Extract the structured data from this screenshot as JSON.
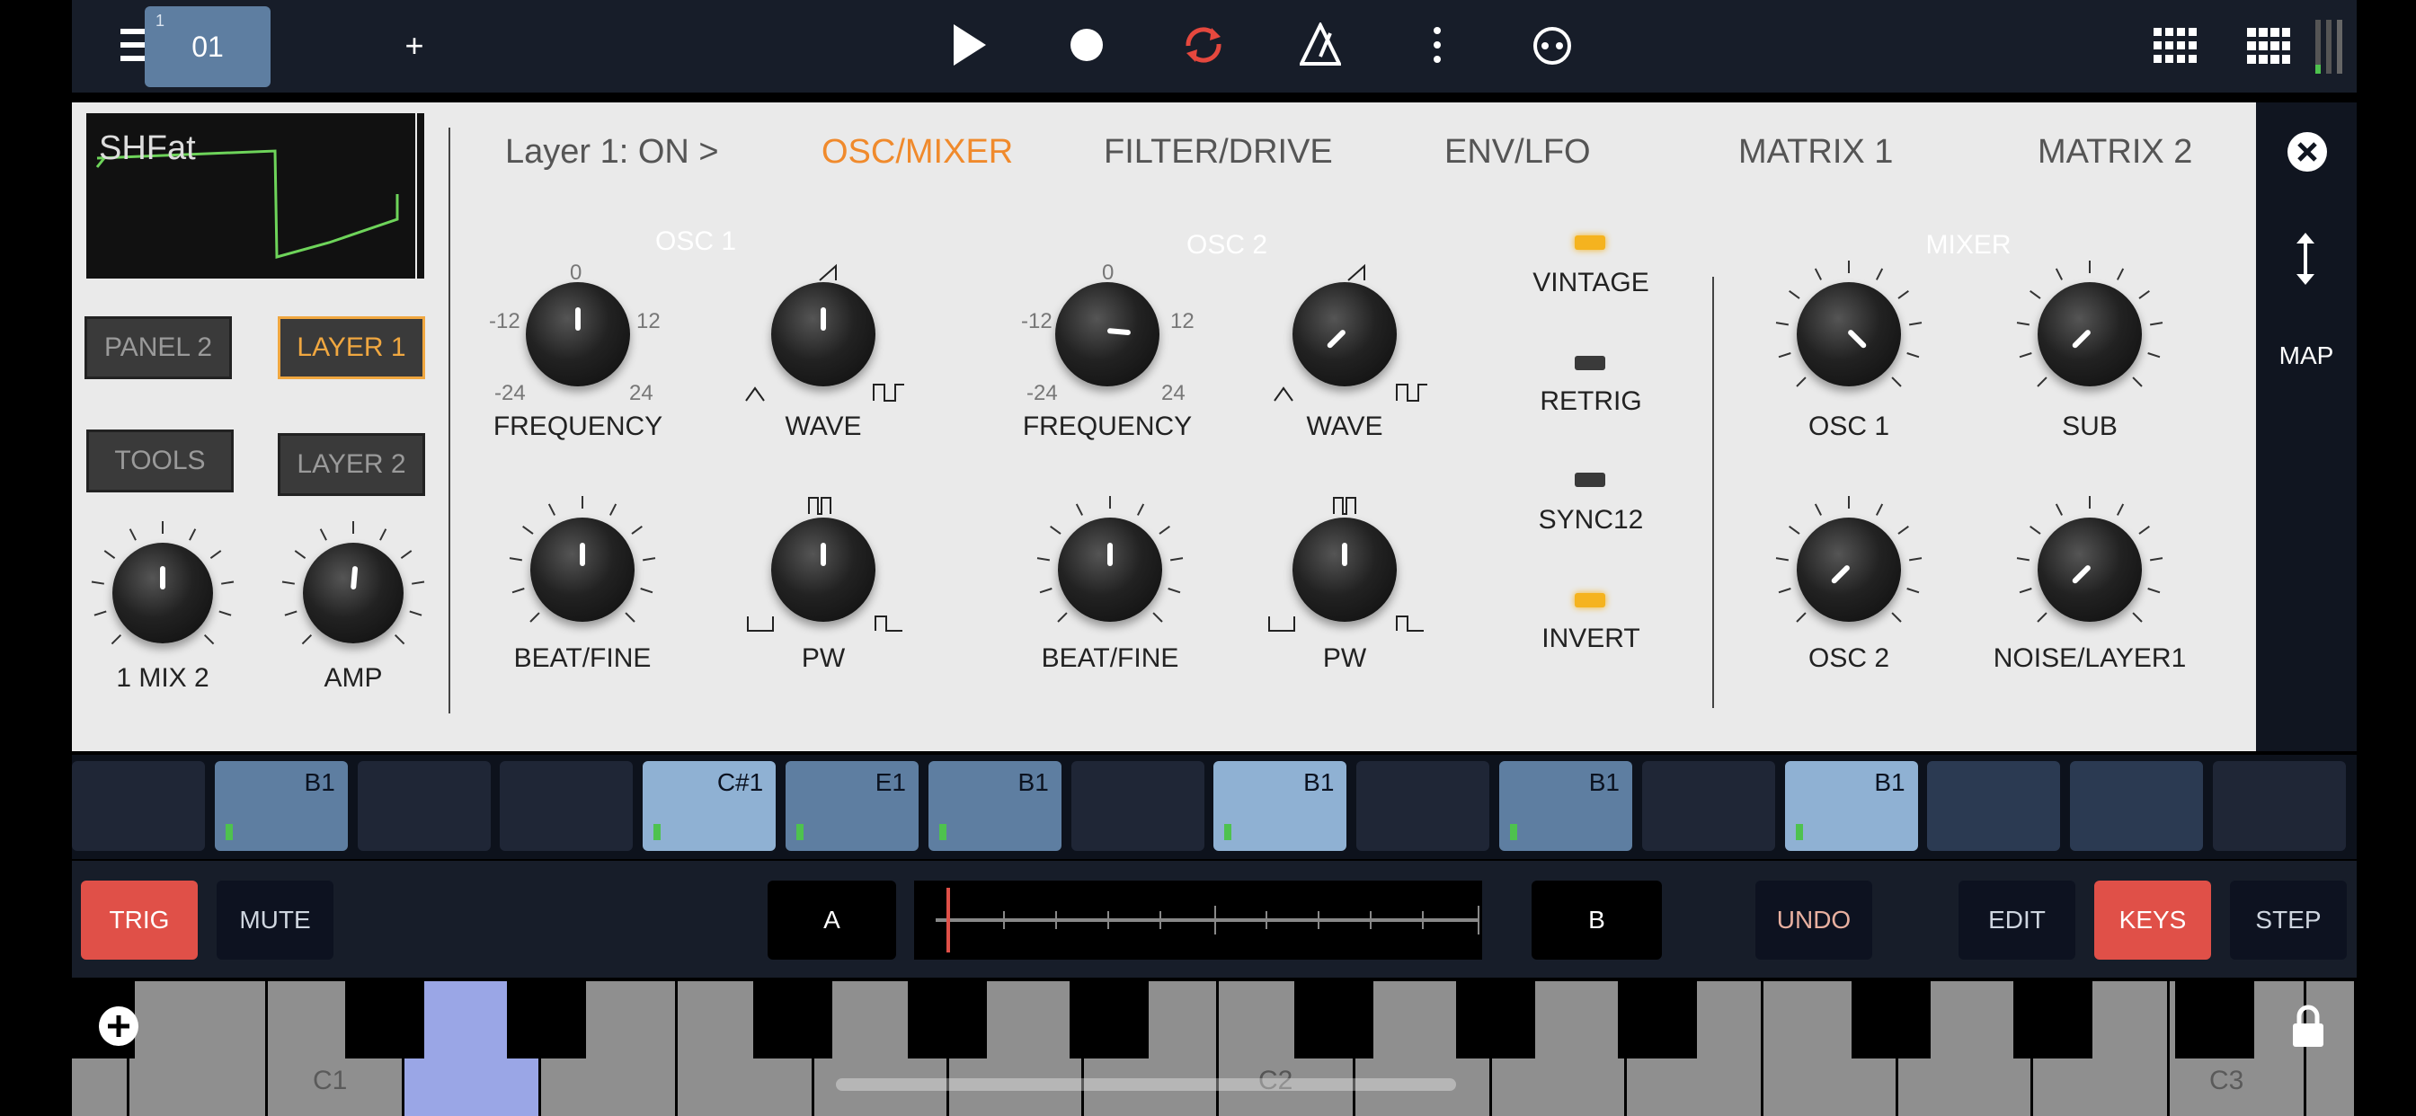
{
  "top_bar": {
    "menu_icon": "hamburger-menu-icon",
    "pattern_number": "1",
    "pattern_label": "01",
    "add_label": "+",
    "transport_icons": [
      "play-icon",
      "record-icon",
      "loop-icon",
      "metronome-icon",
      "more-vertical-icon",
      "link-icon"
    ],
    "right_icons": [
      "grid-view-icon",
      "grid-small-icon",
      "level-meter-icon"
    ]
  },
  "preset": {
    "name": "SHFat"
  },
  "side_buttons": {
    "panel2": "PANEL 2",
    "layer1": "LAYER 1",
    "tools": "TOOLS",
    "layer2": "LAYER 2"
  },
  "tabs": [
    "Layer 1: ON >",
    "OSC/MIXER",
    "FILTER/DRIVE",
    "ENV/LFO",
    "MATRIX 1",
    "MATRIX 2"
  ],
  "active_tab": "OSC/MIXER",
  "sections": {
    "osc1": "OSC 1",
    "osc2": "OSC 2",
    "mixer": "MIXER"
  },
  "knob_labels": {
    "mix": "1 MIX 2",
    "amp": "AMP",
    "osc1_freq": "FREQUENCY",
    "osc1_wave": "WAVE",
    "osc1_beat": "BEAT/FINE",
    "osc1_pw": "PW",
    "osc2_freq": "FREQUENCY",
    "osc2_wave": "WAVE",
    "osc2_beat": "BEAT/FINE",
    "osc2_pw": "PW",
    "mix_osc1": "OSC 1",
    "mix_sub": "SUB",
    "mix_osc2": "OSC 2",
    "mix_noise": "NOISE/LAYER1"
  },
  "freq_scale": {
    "zero": "0",
    "minus12": "-12",
    "plus12": "12",
    "minus24": "-24",
    "plus24": "24"
  },
  "switches": [
    {
      "label": "VINTAGE",
      "on": true
    },
    {
      "label": "RETRIG",
      "on": false
    },
    {
      "label": "SYNC12",
      "on": false
    },
    {
      "label": "INVERT",
      "on": true
    }
  ],
  "right_panel": {
    "close_icon": "close-circle-icon",
    "resize_icon": "vertical-resize-icon",
    "map_label": "MAP"
  },
  "steps": [
    {
      "note": "",
      "state": "empty"
    },
    {
      "note": "B1",
      "state": "mid"
    },
    {
      "note": "",
      "state": "empty"
    },
    {
      "note": "",
      "state": "empty"
    },
    {
      "note": "C#1",
      "state": "light"
    },
    {
      "note": "E1",
      "state": "mid"
    },
    {
      "note": "B1",
      "state": "mid"
    },
    {
      "note": "",
      "state": "empty"
    },
    {
      "note": "B1",
      "state": "light"
    },
    {
      "note": "",
      "state": "empty"
    },
    {
      "note": "B1",
      "state": "mid"
    },
    {
      "note": "",
      "state": "empty"
    },
    {
      "note": "B1",
      "state": "light"
    },
    {
      "note": "",
      "state": "dim"
    },
    {
      "note": "",
      "state": "dim"
    },
    {
      "note": "",
      "state": "empty"
    }
  ],
  "controls": {
    "trig": "TRIG",
    "mute": "MUTE",
    "a": "A",
    "b": "B",
    "undo": "UNDO",
    "edit": "EDIT",
    "keys": "KEYS",
    "step": "STEP"
  },
  "keyboard": {
    "labels": [
      "C1",
      "C2",
      "C3"
    ],
    "add_icon": "add-circle-icon",
    "lock_icon": "lock-icon"
  },
  "colors": {
    "accent_orange": "#f08a2c",
    "active_red": "#e05048",
    "step_light": "#8fb1d3",
    "step_mid": "#5e7ea1",
    "led_on": "#f5b31f",
    "highlight_key": "#9aa6e6"
  }
}
